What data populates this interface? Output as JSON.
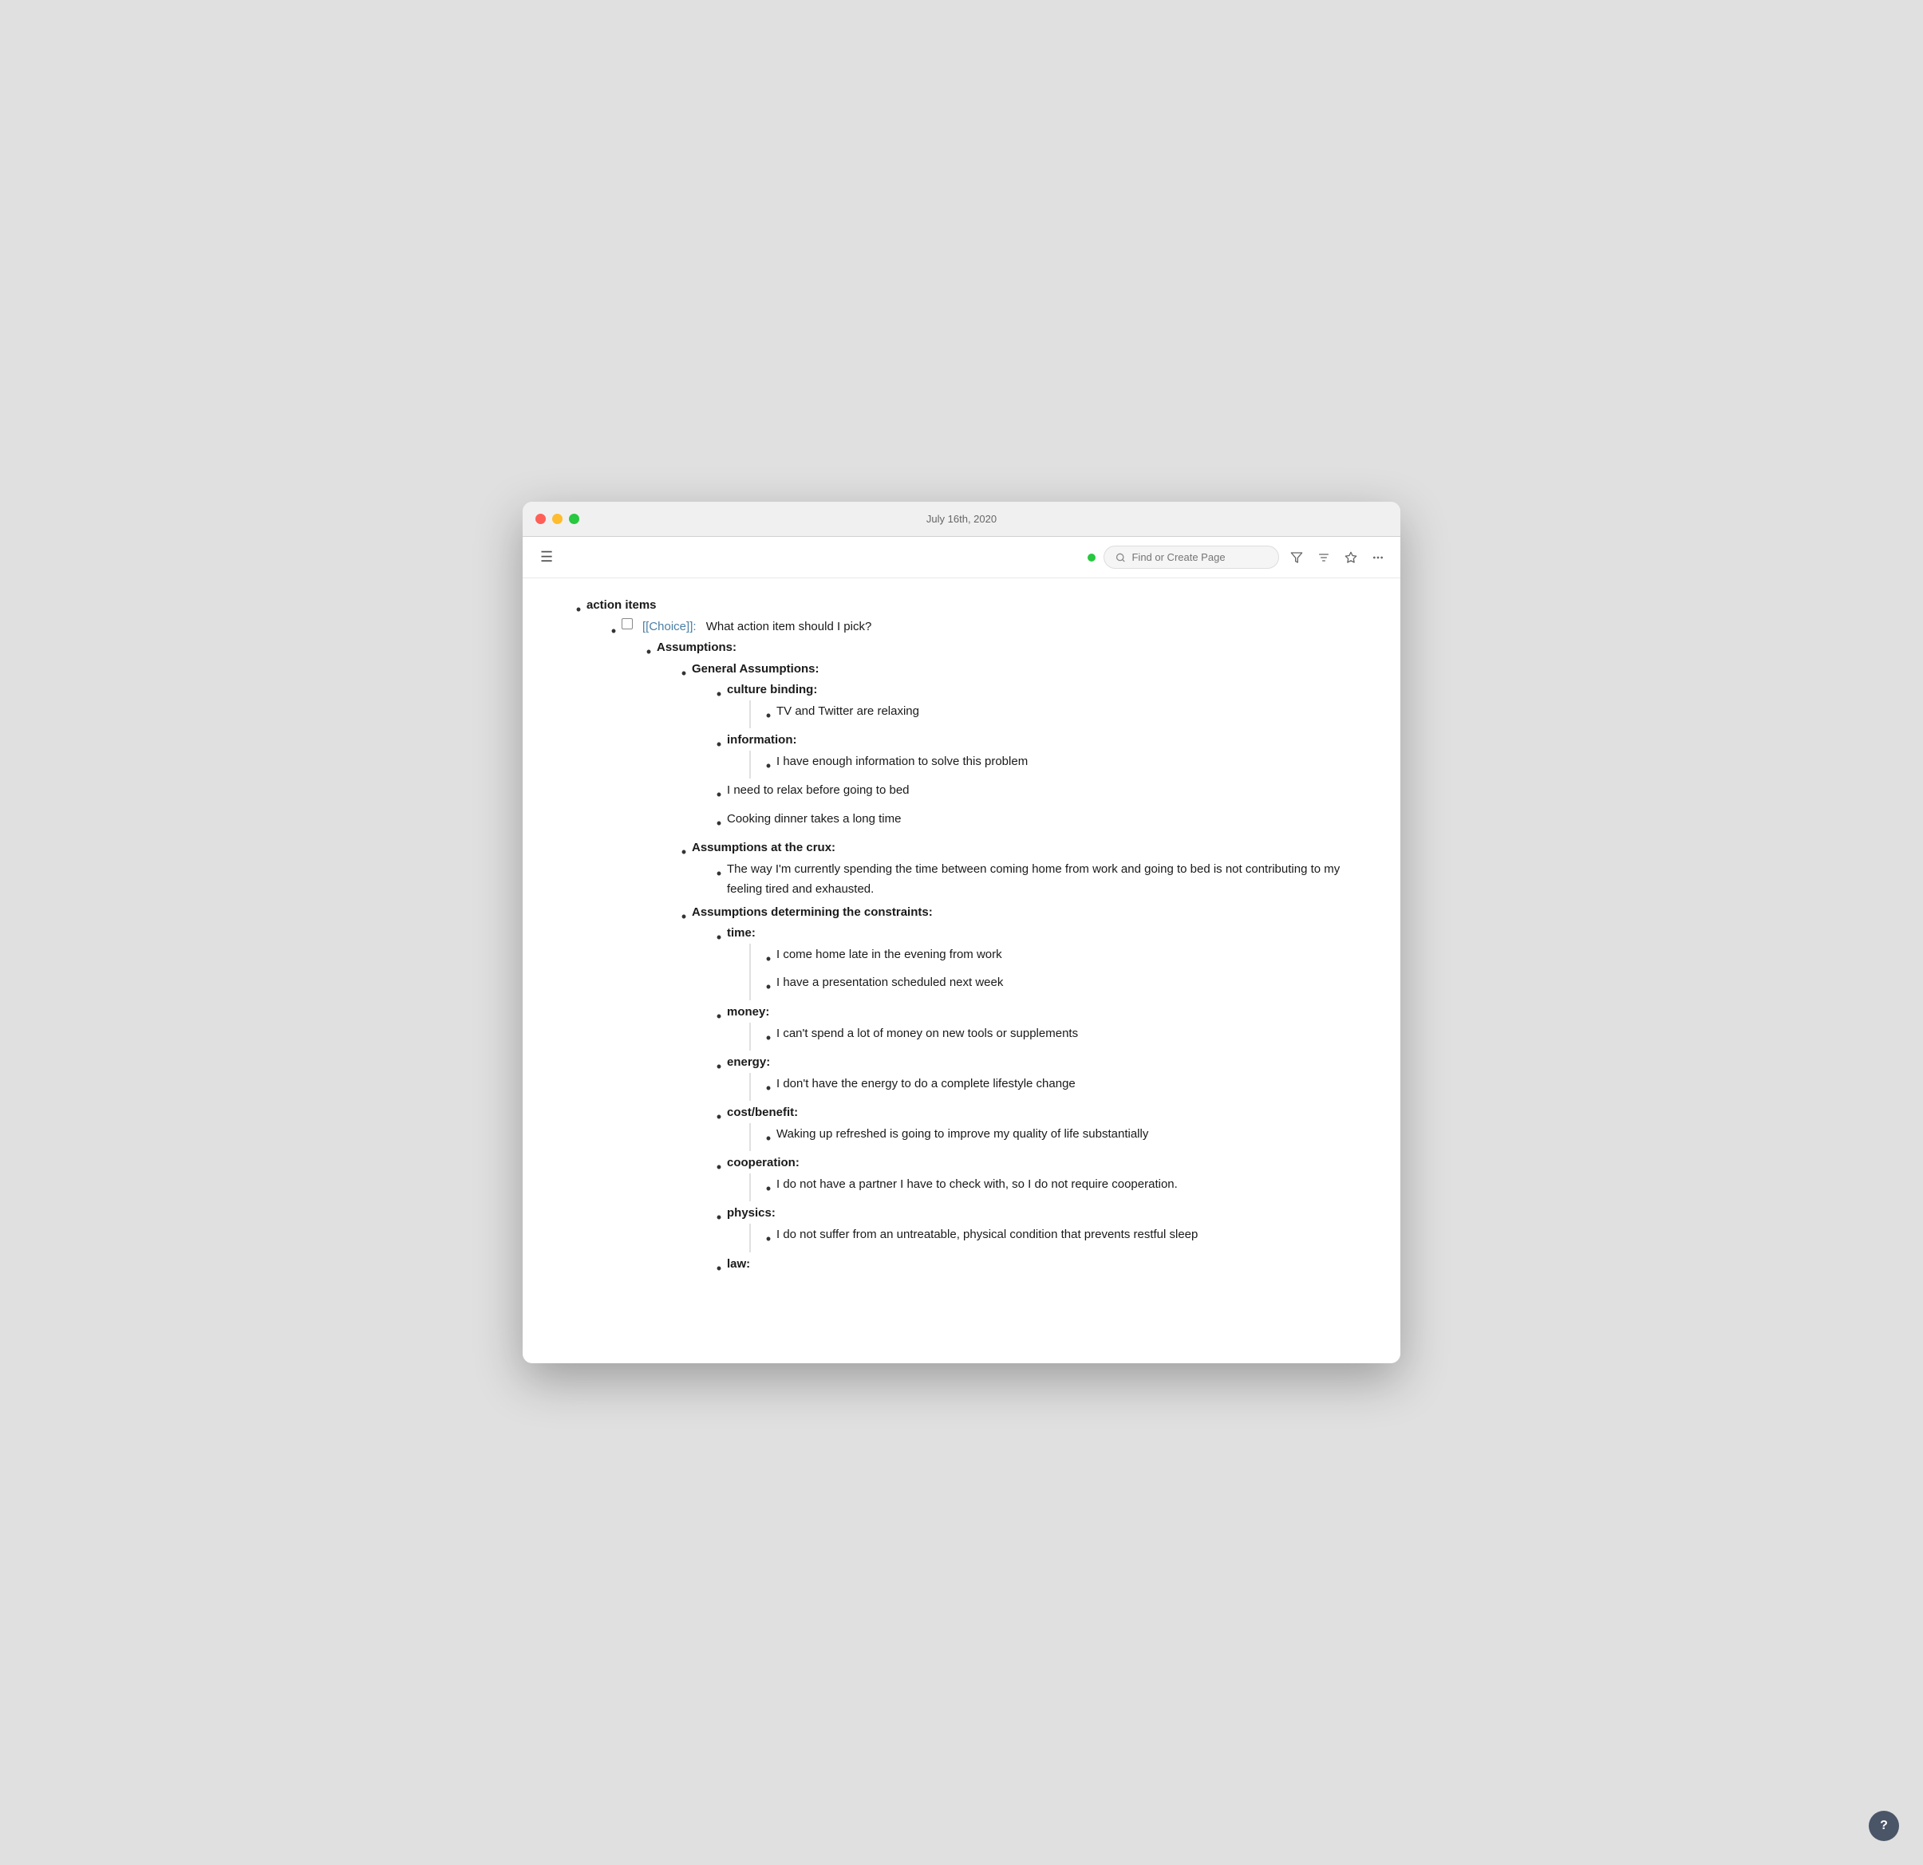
{
  "titlebar": {
    "title": "July 16th, 2020"
  },
  "toolbar": {
    "hamburger_label": "☰",
    "search_placeholder": "Find or Create Page",
    "status_color": "#28c840"
  },
  "content": {
    "root_item": "action items",
    "checkbox_item_prefix": "[[Choice]]:",
    "checkbox_item_text": "What action item should I pick?",
    "sections": [
      {
        "label": "Assumptions:",
        "children": [
          {
            "label": "General Assumptions:",
            "children": [
              {
                "label": "culture binding:",
                "bordered_children": [
                  "TV and Twitter are relaxing"
                ]
              },
              {
                "label": "information:",
                "bordered_children": [
                  "I have enough information to solve this problem"
                ]
              }
            ],
            "extra_items": [
              "I need to relax before going to bed",
              "Cooking dinner takes a long time"
            ]
          },
          {
            "label": "Assumptions at the crux:",
            "plain_children": [
              "The way I'm currently spending the time between coming home from work and going to bed is not contributing to my feeling tired and exhausted."
            ]
          },
          {
            "label": "Assumptions determining the constraints:",
            "children": [
              {
                "label": "time:",
                "bordered_children": [
                  "I come home late in the evening from work",
                  "I have a presentation scheduled next week"
                ]
              },
              {
                "label": "money:",
                "bordered_children": [
                  "I can't spend a lot of money on new tools or supplements"
                ]
              },
              {
                "label": "energy:",
                "bordered_children": [
                  "I don't have the energy to do a complete lifestyle change"
                ]
              },
              {
                "label": "cost/benefit:",
                "bordered_children": [
                  "Waking up refreshed is going to improve my quality of life substantially"
                ]
              },
              {
                "label": "cooperation:",
                "bordered_children": [
                  "I do not have a partner I have to check with, so I do not require cooperation."
                ]
              },
              {
                "label": "physics:",
                "bordered_children": [
                  "I do not suffer from an untreatable, physical condition that prevents restful sleep"
                ]
              }
            ],
            "trailing_label": "law:"
          }
        ]
      }
    ]
  },
  "help_button": {
    "label": "?"
  }
}
